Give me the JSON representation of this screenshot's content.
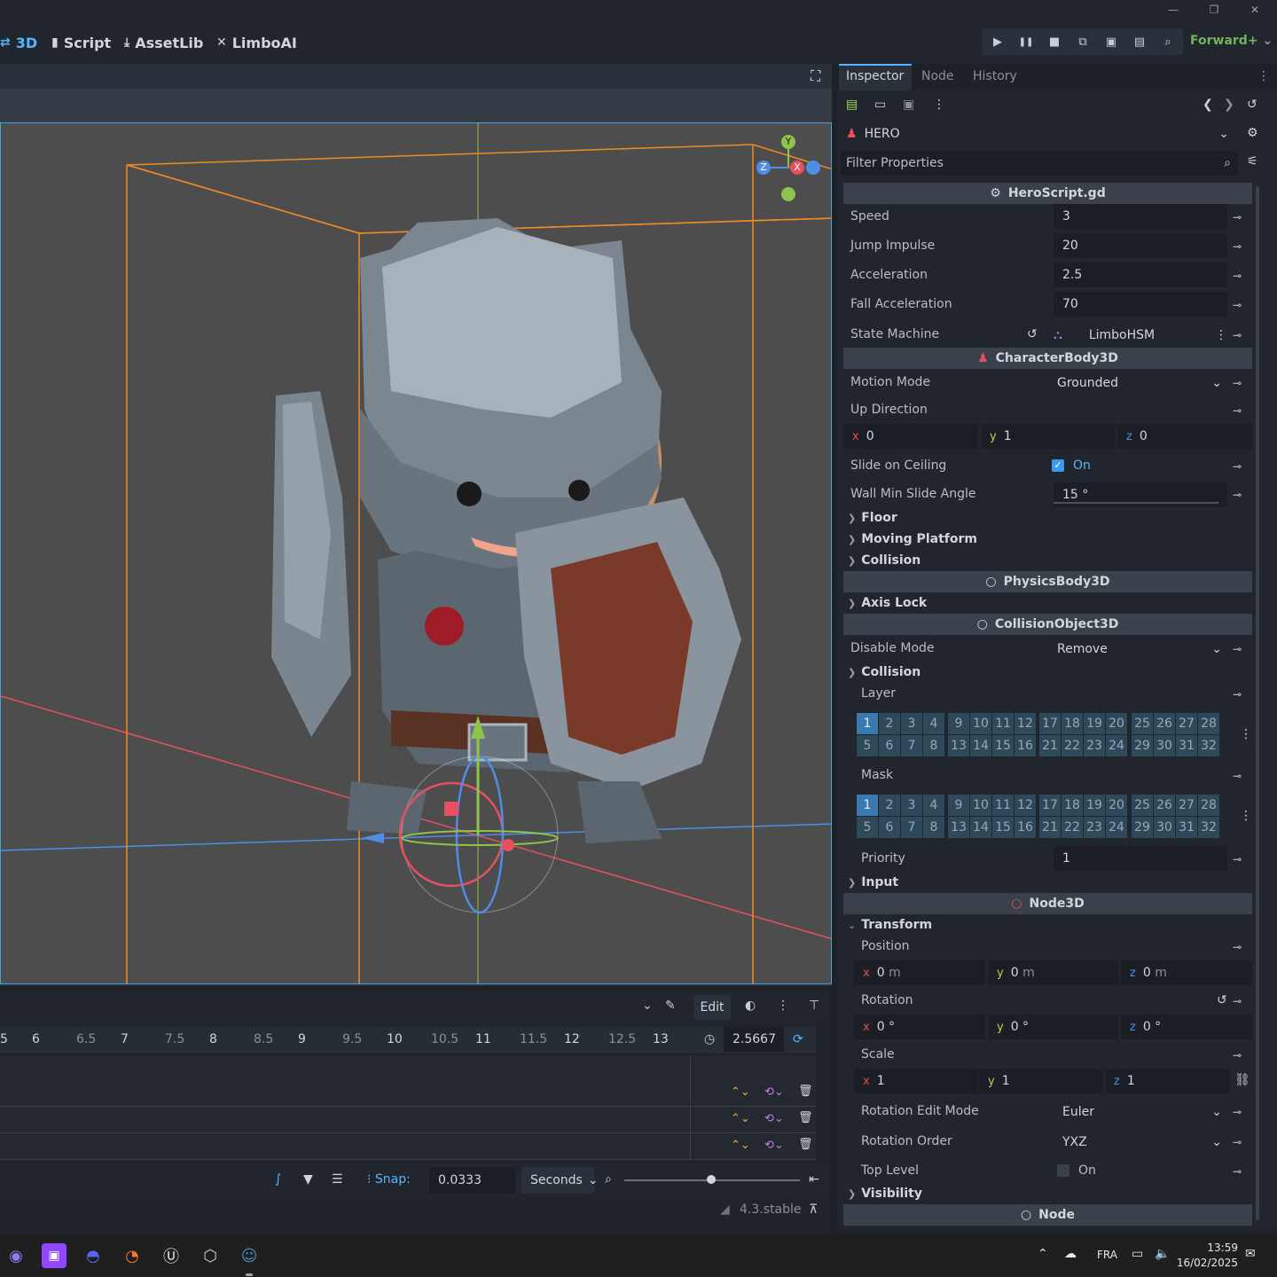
{
  "window": {
    "minimize": "—",
    "maximize": "❐",
    "close": "✕"
  },
  "workspaces": [
    {
      "label": "3D",
      "icon": "⇄"
    },
    {
      "label": "Script",
      "icon": "▮"
    },
    {
      "label": "AssetLib",
      "icon": "⤓"
    },
    {
      "label": "LimboAI",
      "icon": "✕"
    }
  ],
  "run_buttons": [
    "▶",
    "❚❚",
    "■",
    "⧉",
    "▣",
    "▤",
    "⌕"
  ],
  "renderer": "Forward+",
  "viewport": {
    "fullscreen_icon": "⛶"
  },
  "gizmo": {
    "x": "X",
    "y": "Y",
    "z": "Z"
  },
  "animation": {
    "edit_label": "Edit",
    "ticks": [
      "5",
      "6",
      "6.5",
      "7",
      "7.5",
      "8",
      "8.5",
      "9",
      "9.5",
      "10",
      "10.5",
      "11",
      "11.5",
      "12",
      "12.5",
      "13"
    ],
    "current_time": "2.5667",
    "snap_label": "Snap:",
    "snap_value": "0.0333",
    "snap_unit": "Seconds",
    "version": "4.3.stable"
  },
  "inspector": {
    "tabs": [
      "Inspector",
      "Node",
      "History"
    ],
    "node_name": "HERO",
    "filter_placeholder": "Filter Properties",
    "sections": {
      "script": "HeroScript.gd",
      "body": "CharacterBody3D",
      "physics": "PhysicsBody3D",
      "collision_object": "CollisionObject3D",
      "node3d": "Node3D",
      "node": "Node"
    },
    "script_props": [
      {
        "label": "Speed",
        "value": "3"
      },
      {
        "label": "Jump Impulse",
        "value": "20"
      },
      {
        "label": "Acceleration",
        "value": "2.5"
      },
      {
        "label": "Fall Acceleration",
        "value": "70"
      }
    ],
    "state_machine": {
      "label": "State Machine",
      "value": "LimboHSM"
    },
    "motion_mode": {
      "label": "Motion Mode",
      "value": "Grounded"
    },
    "up_direction": {
      "label": "Up Direction",
      "x": "0",
      "y": "1",
      "z": "0"
    },
    "slide_on_ceiling": {
      "label": "Slide on Ceiling",
      "value": "On"
    },
    "wall_min_slide": {
      "label": "Wall Min Slide Angle",
      "value": "15 °"
    },
    "groups": {
      "floor": "Floor",
      "moving_platform": "Moving Platform",
      "collision": "Collision",
      "axis_lock": "Axis Lock",
      "collision2": "Collision",
      "input": "Input",
      "transform": "Transform",
      "visibility": "Visibility"
    },
    "disable_mode": {
      "label": "Disable Mode",
      "value": "Remove"
    },
    "layer_label": "Layer",
    "mask_label": "Mask",
    "priority": {
      "label": "Priority",
      "value": "1"
    },
    "position": {
      "label": "Position",
      "x": "0",
      "y": "0",
      "z": "0",
      "unit": "m"
    },
    "rotation": {
      "label": "Rotation",
      "x": "0 °",
      "y": "0 °",
      "z": "0 °"
    },
    "scale": {
      "label": "Scale",
      "x": "1",
      "y": "1",
      "z": "1"
    },
    "rotation_edit_mode": {
      "label": "Rotation Edit Mode",
      "value": "Euler"
    },
    "rotation_order": {
      "label": "Rotation Order",
      "value": "YXZ"
    },
    "top_level": {
      "label": "Top Level",
      "value": "On"
    }
  },
  "taskbar": {
    "lang": "FRA",
    "time": "13:59",
    "date": "16/02/2025"
  }
}
